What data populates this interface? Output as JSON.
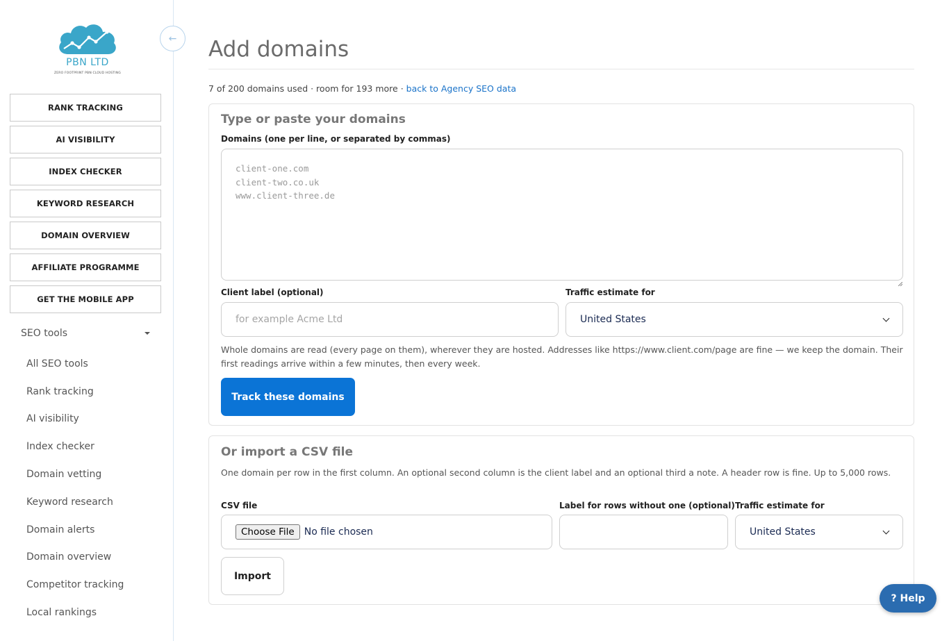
{
  "brand": {
    "name": "PBN LTD",
    "tagline": "ZERO FOOTPRINT PBN CLOUD HOSTING",
    "color": "#3aa6c9"
  },
  "sidebar": {
    "collapse_icon": "arrow-left-icon",
    "buttons": [
      {
        "label": "RANK TRACKING"
      },
      {
        "label": "AI VISIBILITY"
      },
      {
        "label": "INDEX CHECKER"
      },
      {
        "label": "KEYWORD RESEARCH"
      },
      {
        "label": "DOMAIN OVERVIEW"
      },
      {
        "label": "AFFILIATE PROGRAMME"
      },
      {
        "label": "GET THE MOBILE APP"
      }
    ],
    "section": {
      "label": "SEO tools",
      "icon": "caret-down-icon",
      "links": [
        {
          "label": "All SEO tools"
        },
        {
          "label": "Rank tracking"
        },
        {
          "label": "AI visibility"
        },
        {
          "label": "Index checker"
        },
        {
          "label": "Domain vetting"
        },
        {
          "label": "Keyword research"
        },
        {
          "label": "Domain alerts"
        },
        {
          "label": "Domain overview"
        },
        {
          "label": "Competitor tracking"
        },
        {
          "label": "Local rankings"
        }
      ]
    }
  },
  "main": {
    "title": "Add domains",
    "usage": {
      "text": "7 of 200 domains used · room for 193 more · ",
      "link": "back to Agency SEO data"
    },
    "manual": {
      "title": "Type or paste your domains",
      "domains_label": "Domains (one per line, or separated by commas)",
      "domains_placeholder": "client-one.com\nclient-two.co.uk\nwww.client-three.de",
      "client_label": "Client label (optional)",
      "client_placeholder": "for example Acme Ltd",
      "traffic_label": "Traffic estimate for",
      "traffic_value": "United States",
      "help": "Whole domains are read (every page on them), wherever they are hosted. Addresses like https://www.client.com/page are fine — we keep the domain. Their first readings arrive within a few minutes, then every week.",
      "submit_label": "Track these domains"
    },
    "csv": {
      "title": "Or import a CSV file",
      "help": "One domain per row in the first column. An optional second column is the client label and an optional third a note. A header row is fine. Up to 5,000 rows.",
      "file_label": "CSV file",
      "file_button": "Choose File",
      "file_status": "No file chosen",
      "row_label": "Label for rows without one (optional)",
      "row_value": "",
      "traffic_label": "Traffic estimate for",
      "traffic_value": "United States",
      "import_label": "Import"
    }
  },
  "help_fab": {
    "label": "? Help"
  },
  "colors": {
    "primary": "#0b74d6",
    "link": "#1a73c9",
    "fab": "#2b6cb0"
  }
}
